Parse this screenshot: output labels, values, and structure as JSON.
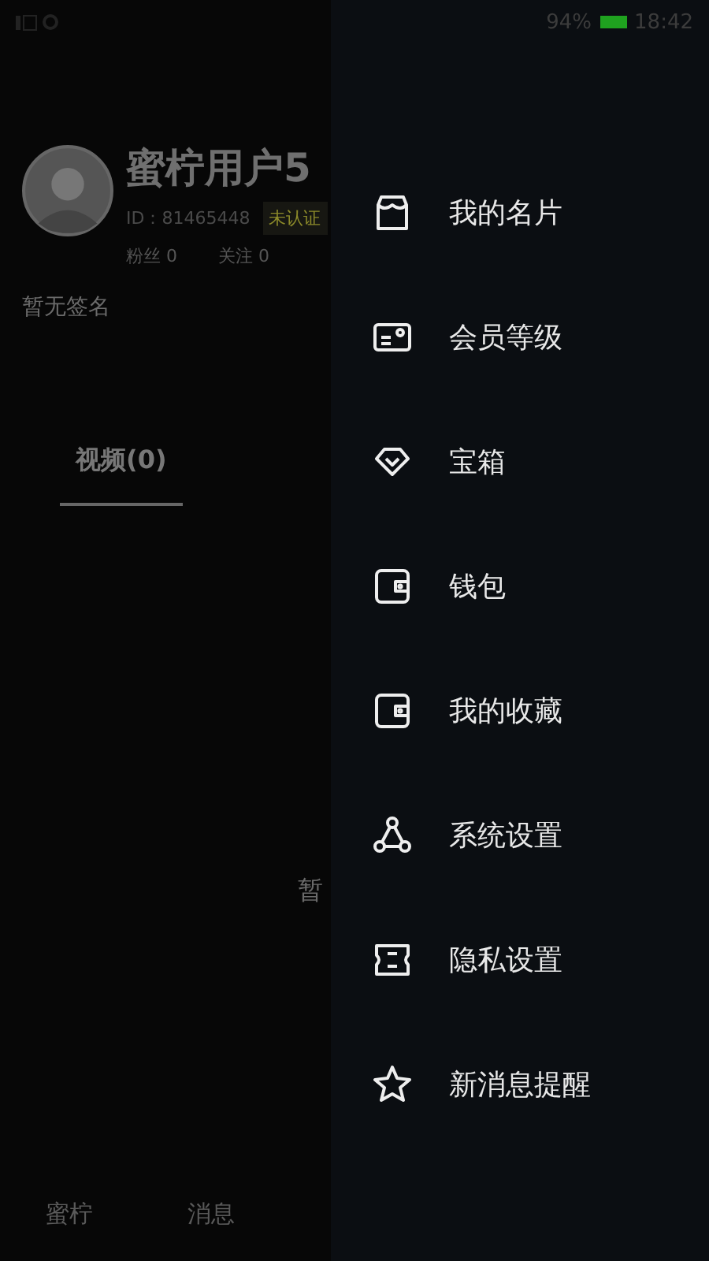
{
  "status_bar": {
    "battery": "94%",
    "time": "18:42"
  },
  "profile": {
    "name": "蜜柠用户5",
    "id": "ID：81465448",
    "badge": "未认证",
    "fans_label": "粉丝",
    "fans_count": "0",
    "following_label": "关注",
    "following_count": "0",
    "signature": "暂无签名"
  },
  "tabs": [
    {
      "label": "视频(0)",
      "selected": true
    }
  ],
  "empty_state": {
    "text": "暂"
  },
  "bottom_nav": [
    {
      "label": "蜜柠"
    },
    {
      "label": "消息"
    }
  ],
  "drawer": {
    "items": [
      {
        "label": "我的名片"
      },
      {
        "label": "会员等级"
      },
      {
        "label": "宝箱"
      },
      {
        "label": "钱包"
      },
      {
        "label": "我的收藏"
      },
      {
        "label": "系统设置"
      },
      {
        "label": "隐私设置"
      },
      {
        "label": "新消息提醒"
      }
    ]
  }
}
